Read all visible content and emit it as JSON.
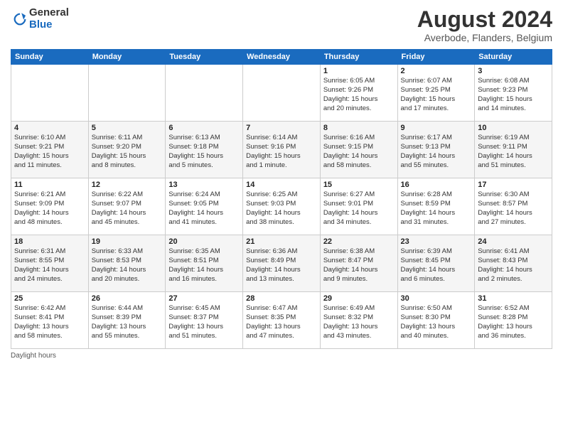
{
  "logo": {
    "general": "General",
    "blue": "Blue"
  },
  "title": "August 2024",
  "location": "Averbode, Flanders, Belgium",
  "days_of_week": [
    "Sunday",
    "Monday",
    "Tuesday",
    "Wednesday",
    "Thursday",
    "Friday",
    "Saturday"
  ],
  "footer_text": "Daylight hours",
  "weeks": [
    [
      {
        "day": "",
        "info": ""
      },
      {
        "day": "",
        "info": ""
      },
      {
        "day": "",
        "info": ""
      },
      {
        "day": "",
        "info": ""
      },
      {
        "day": "1",
        "info": "Sunrise: 6:05 AM\nSunset: 9:26 PM\nDaylight: 15 hours\nand 20 minutes."
      },
      {
        "day": "2",
        "info": "Sunrise: 6:07 AM\nSunset: 9:25 PM\nDaylight: 15 hours\nand 17 minutes."
      },
      {
        "day": "3",
        "info": "Sunrise: 6:08 AM\nSunset: 9:23 PM\nDaylight: 15 hours\nand 14 minutes."
      }
    ],
    [
      {
        "day": "4",
        "info": "Sunrise: 6:10 AM\nSunset: 9:21 PM\nDaylight: 15 hours\nand 11 minutes."
      },
      {
        "day": "5",
        "info": "Sunrise: 6:11 AM\nSunset: 9:20 PM\nDaylight: 15 hours\nand 8 minutes."
      },
      {
        "day": "6",
        "info": "Sunrise: 6:13 AM\nSunset: 9:18 PM\nDaylight: 15 hours\nand 5 minutes."
      },
      {
        "day": "7",
        "info": "Sunrise: 6:14 AM\nSunset: 9:16 PM\nDaylight: 15 hours\nand 1 minute."
      },
      {
        "day": "8",
        "info": "Sunrise: 6:16 AM\nSunset: 9:15 PM\nDaylight: 14 hours\nand 58 minutes."
      },
      {
        "day": "9",
        "info": "Sunrise: 6:17 AM\nSunset: 9:13 PM\nDaylight: 14 hours\nand 55 minutes."
      },
      {
        "day": "10",
        "info": "Sunrise: 6:19 AM\nSunset: 9:11 PM\nDaylight: 14 hours\nand 51 minutes."
      }
    ],
    [
      {
        "day": "11",
        "info": "Sunrise: 6:21 AM\nSunset: 9:09 PM\nDaylight: 14 hours\nand 48 minutes."
      },
      {
        "day": "12",
        "info": "Sunrise: 6:22 AM\nSunset: 9:07 PM\nDaylight: 14 hours\nand 45 minutes."
      },
      {
        "day": "13",
        "info": "Sunrise: 6:24 AM\nSunset: 9:05 PM\nDaylight: 14 hours\nand 41 minutes."
      },
      {
        "day": "14",
        "info": "Sunrise: 6:25 AM\nSunset: 9:03 PM\nDaylight: 14 hours\nand 38 minutes."
      },
      {
        "day": "15",
        "info": "Sunrise: 6:27 AM\nSunset: 9:01 PM\nDaylight: 14 hours\nand 34 minutes."
      },
      {
        "day": "16",
        "info": "Sunrise: 6:28 AM\nSunset: 8:59 PM\nDaylight: 14 hours\nand 31 minutes."
      },
      {
        "day": "17",
        "info": "Sunrise: 6:30 AM\nSunset: 8:57 PM\nDaylight: 14 hours\nand 27 minutes."
      }
    ],
    [
      {
        "day": "18",
        "info": "Sunrise: 6:31 AM\nSunset: 8:55 PM\nDaylight: 14 hours\nand 24 minutes."
      },
      {
        "day": "19",
        "info": "Sunrise: 6:33 AM\nSunset: 8:53 PM\nDaylight: 14 hours\nand 20 minutes."
      },
      {
        "day": "20",
        "info": "Sunrise: 6:35 AM\nSunset: 8:51 PM\nDaylight: 14 hours\nand 16 minutes."
      },
      {
        "day": "21",
        "info": "Sunrise: 6:36 AM\nSunset: 8:49 PM\nDaylight: 14 hours\nand 13 minutes."
      },
      {
        "day": "22",
        "info": "Sunrise: 6:38 AM\nSunset: 8:47 PM\nDaylight: 14 hours\nand 9 minutes."
      },
      {
        "day": "23",
        "info": "Sunrise: 6:39 AM\nSunset: 8:45 PM\nDaylight: 14 hours\nand 6 minutes."
      },
      {
        "day": "24",
        "info": "Sunrise: 6:41 AM\nSunset: 8:43 PM\nDaylight: 14 hours\nand 2 minutes."
      }
    ],
    [
      {
        "day": "25",
        "info": "Sunrise: 6:42 AM\nSunset: 8:41 PM\nDaylight: 13 hours\nand 58 minutes."
      },
      {
        "day": "26",
        "info": "Sunrise: 6:44 AM\nSunset: 8:39 PM\nDaylight: 13 hours\nand 55 minutes."
      },
      {
        "day": "27",
        "info": "Sunrise: 6:45 AM\nSunset: 8:37 PM\nDaylight: 13 hours\nand 51 minutes."
      },
      {
        "day": "28",
        "info": "Sunrise: 6:47 AM\nSunset: 8:35 PM\nDaylight: 13 hours\nand 47 minutes."
      },
      {
        "day": "29",
        "info": "Sunrise: 6:49 AM\nSunset: 8:32 PM\nDaylight: 13 hours\nand 43 minutes."
      },
      {
        "day": "30",
        "info": "Sunrise: 6:50 AM\nSunset: 8:30 PM\nDaylight: 13 hours\nand 40 minutes."
      },
      {
        "day": "31",
        "info": "Sunrise: 6:52 AM\nSunset: 8:28 PM\nDaylight: 13 hours\nand 36 minutes."
      }
    ]
  ]
}
